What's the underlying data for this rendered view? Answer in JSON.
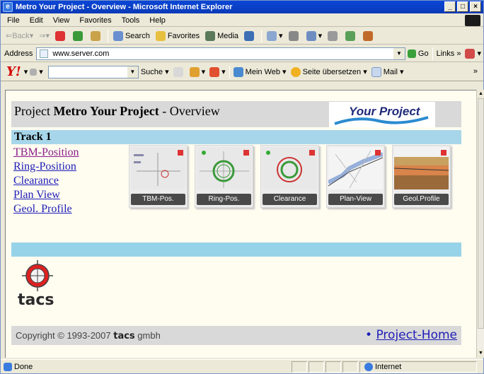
{
  "window": {
    "title": "Metro Your Project - Overview - Microsoft Internet Explorer"
  },
  "menu": [
    "File",
    "Edit",
    "View",
    "Favorites",
    "Tools",
    "Help"
  ],
  "toolbar": {
    "back": "Back",
    "search": "Search",
    "favorites": "Favorites",
    "media": "Media"
  },
  "address": {
    "label": "Address",
    "url": "www.server.com",
    "go": "Go",
    "links": "Links"
  },
  "yahoo": {
    "logo": "Y!",
    "suche": "Suche",
    "meinweb": "Mein Web",
    "translate": "Seite übersetzen",
    "mail": "Mail"
  },
  "page": {
    "project_prefix": "Project ",
    "project_name": "Metro Your Project",
    "project_suffix": " - Overview",
    "logo_text": "Your Project",
    "track": "Track 1",
    "links": [
      "TBM-Position",
      "Ring-Position",
      "Clearance",
      "Plan View",
      "Geol. Profile"
    ],
    "thumbnails": [
      "TBM-Pos.",
      "Ring-Pos.",
      "Clearance",
      "Plan-View",
      "Geol.Profile"
    ],
    "tacs_text": "tacs",
    "copyright_prefix": "Copyright © 1993-2007 ",
    "copyright_brand": "tacs",
    "copyright_suffix": " gmbh",
    "home_link": "Project-Home"
  },
  "status": {
    "left": "Done",
    "zone": "Internet"
  },
  "colors": {
    "track_bar": "#a7d6ea",
    "link": "#1e1eb8",
    "visited": "#8a1e8a"
  }
}
